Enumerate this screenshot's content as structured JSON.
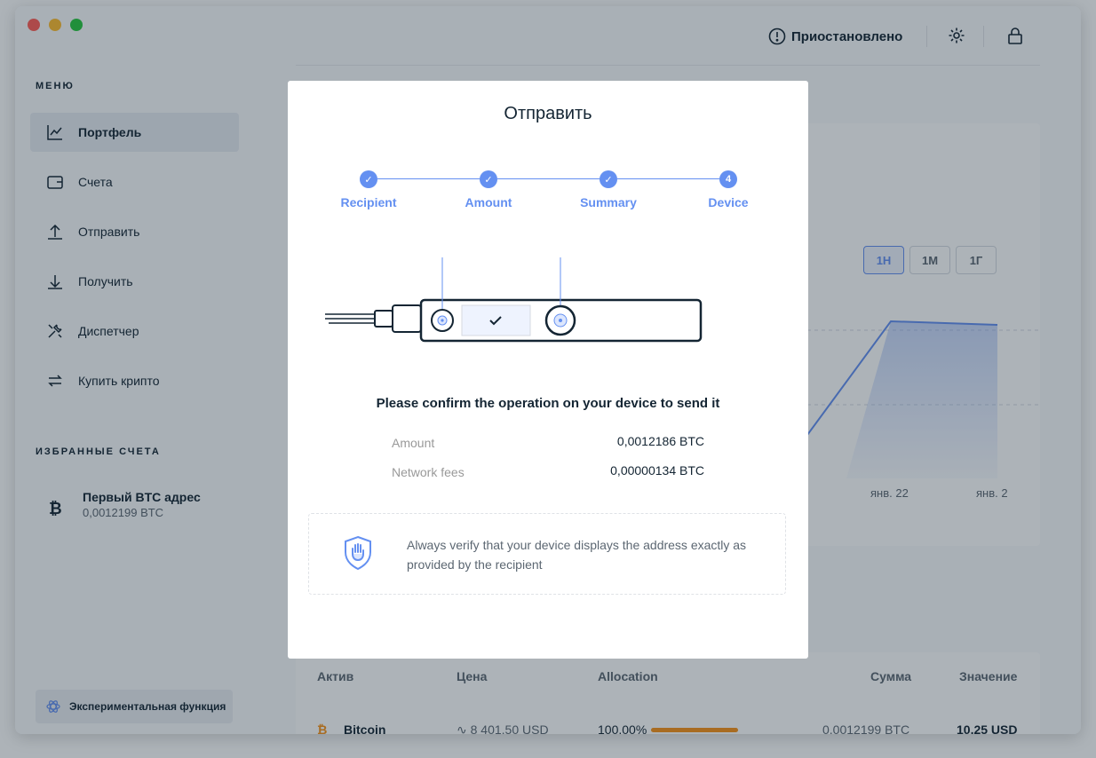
{
  "sidebar": {
    "menu_title": "МЕНЮ",
    "items": [
      {
        "label": "Портфель",
        "icon": "chart-line-icon",
        "active": true
      },
      {
        "label": "Счета",
        "icon": "wallet-icon"
      },
      {
        "label": "Отправить",
        "icon": "upload-icon"
      },
      {
        "label": "Получить",
        "icon": "download-icon"
      },
      {
        "label": "Диспетчер",
        "icon": "tools-icon"
      },
      {
        "label": "Купить крипто",
        "icon": "exchange-icon"
      }
    ],
    "favorites_title": "ИЗБРАННЫЕ СЧЕТА",
    "favorite": {
      "name": "Первый BTC адрес",
      "balance": "0,0012199 BTC",
      "icon": "bitcoin-icon"
    },
    "experimental": "Экспериментальная функция"
  },
  "topbar": {
    "status": "Приостановлено",
    "status_icon": "exclamation-circle-icon",
    "settings_icon": "gear-icon",
    "lock_icon": "lock-icon"
  },
  "chart": {
    "ranges": [
      "1Н",
      "1М",
      "1Г"
    ],
    "active_range": "1Н",
    "x_labels": [
      "янв. 22",
      "янв. 2"
    ]
  },
  "assets_table": {
    "headers": [
      "Актив",
      "Цена",
      "Allocation",
      "Сумма",
      "Значение"
    ],
    "row": {
      "name": "Bitcoin",
      "price": "8 401,50 USD",
      "allocation": "100,00%",
      "allocation_fraction": 1.0,
      "amount": "0,0012199 BTC",
      "value": "10,25 USD"
    }
  },
  "modal": {
    "title": "Отправить",
    "steps": [
      {
        "label": "Recipient",
        "state": "done"
      },
      {
        "label": "Amount",
        "state": "done"
      },
      {
        "label": "Summary",
        "state": "done"
      },
      {
        "label": "Device",
        "state": "current",
        "number": "4"
      }
    ],
    "confirm_text": "Please confirm the operation on your device to send it",
    "rows": [
      {
        "label": "Amount",
        "value": "0,0012186 BTC"
      },
      {
        "label": "Network fees",
        "value": "0,00000134 BTC"
      }
    ],
    "notice": "Always verify that your device displays the address exactly as provided by the recipient",
    "notice_icon": "shield-hand-icon"
  },
  "colors": {
    "accent": "#6490f1",
    "bitcoin": "#f7931a",
    "text": "#142533",
    "muted": "#999999"
  }
}
